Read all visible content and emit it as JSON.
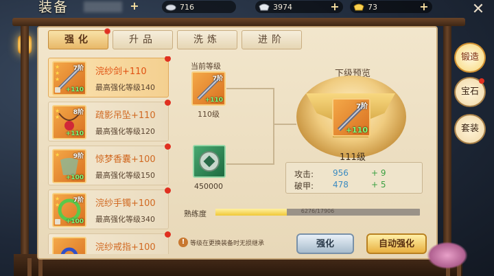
{
  "window": {
    "title": "装备"
  },
  "resources": [
    {
      "icon": "silver-icon",
      "value": "716"
    },
    {
      "icon": "silver-ingot-icon",
      "value": "3974"
    },
    {
      "icon": "gold-ingot-icon",
      "value": "73"
    }
  ],
  "tabs": [
    {
      "label": "强化",
      "active": true,
      "badge": true
    },
    {
      "label": "升品",
      "active": false,
      "badge": false
    },
    {
      "label": "洗炼",
      "active": false,
      "badge": false
    },
    {
      "label": "进阶",
      "active": false,
      "badge": false
    }
  ],
  "equipment_list": [
    {
      "name": "浣纱剑+110",
      "grade": "7阶",
      "level": "+110",
      "max": "最高强化等级140",
      "selected": true
    },
    {
      "name": "疏影吊坠+110",
      "grade": "8阶",
      "level": "+110",
      "max": "最高强化等级120",
      "selected": false
    },
    {
      "name": "惊梦香囊+100",
      "grade": "9阶",
      "level": "+100",
      "max": "最高强化等级150",
      "selected": false
    },
    {
      "name": "浣纱手镯+100",
      "grade": "7阶",
      "level": "+100",
      "max": "最高强化等级340",
      "selected": false
    },
    {
      "name": "浣纱戒指+100",
      "grade": "",
      "level": "",
      "max": "",
      "selected": false
    }
  ],
  "current": {
    "label": "当前等级",
    "grade": "7阶",
    "level": "+110",
    "level_text": "110级"
  },
  "material": {
    "cost": "450000"
  },
  "preview": {
    "label": "下级预览",
    "grade": "7阶",
    "level": "+110",
    "level_text": "111级",
    "stats": [
      {
        "name": "攻击:",
        "value": "956",
        "inc": "+ 9"
      },
      {
        "name": "破甲:",
        "value": "478",
        "inc": "+ 5"
      }
    ]
  },
  "proficiency": {
    "label": "熟练度",
    "current": 6276,
    "max": 17906,
    "text": "6276/17906"
  },
  "note": {
    "icon": "!",
    "text": "等级在更换装备时无损继承"
  },
  "buttons": {
    "strengthen": "强化",
    "auto": "自动强化"
  },
  "side_tabs": [
    {
      "label": "锻造",
      "active": true
    },
    {
      "label": "宝石",
      "active": false
    },
    {
      "label": "套装",
      "active": false
    }
  ],
  "close_label": "✕"
}
